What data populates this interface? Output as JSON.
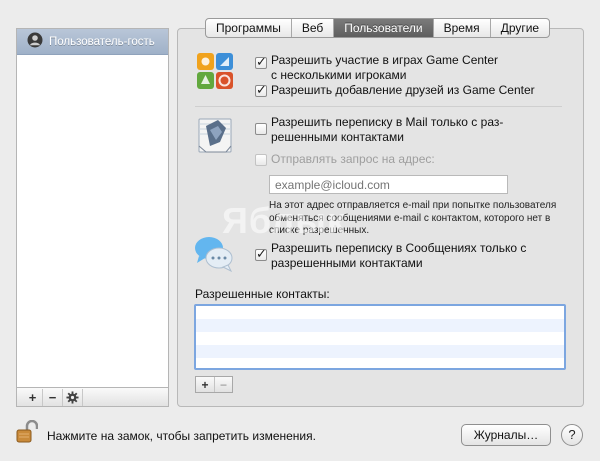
{
  "tabs": [
    {
      "label": "Программы",
      "active": false
    },
    {
      "label": "Веб",
      "active": false
    },
    {
      "label": "Пользователи",
      "active": true
    },
    {
      "label": "Время",
      "active": false
    },
    {
      "label": "Другие",
      "active": false
    }
  ],
  "sidebar": {
    "users": [
      {
        "name": "Пользователь-гость",
        "selected": true
      }
    ],
    "add_label": "+",
    "remove_label": "−",
    "gear_icon": "gear-icon"
  },
  "game_center": {
    "icon": "game-center-icon",
    "allow_multiplayer": {
      "label_line1": "Разрешить участие в играх Game Center",
      "label_line2": "с несколькими игроками",
      "checked": true
    },
    "allow_friends": {
      "label": "Разрешить добавление друзей из Game Center",
      "checked": true
    }
  },
  "mail": {
    "icon": "mail-icon",
    "limit_mail": {
      "label_line1": "Разрешить переписку в Mail только с раз-",
      "label_line2": "решенными контактами",
      "checked": false
    },
    "send_request": {
      "label": "Отправлять запрос на адрес:",
      "checked": false,
      "disabled": true
    },
    "email_placeholder": "example@icloud.com",
    "note": "На этот адрес отправляется e-mail при попытке пользователя обменяться сообщениями e-mail с контактом, которого нет в списке разрешенных."
  },
  "messages": {
    "icon": "messages-icon",
    "limit_messages": {
      "label_line1": "Разрешить переписку в Сообщениях только с",
      "label_line2": "разрешенными контактами",
      "checked": true
    }
  },
  "contacts": {
    "label": "Разрешенные контакты:",
    "add_label": "+",
    "remove_label": "−"
  },
  "footer": {
    "lock_text": "Нажмите на замок, чтобы запретить изменения.",
    "logs_button": "Журналы…",
    "help_button": "?"
  },
  "watermark": "Яблык",
  "colors": {
    "tab_active": "#6a6a6a",
    "selection": "#a9b9cf",
    "focus_ring": "#7ca6e0"
  }
}
